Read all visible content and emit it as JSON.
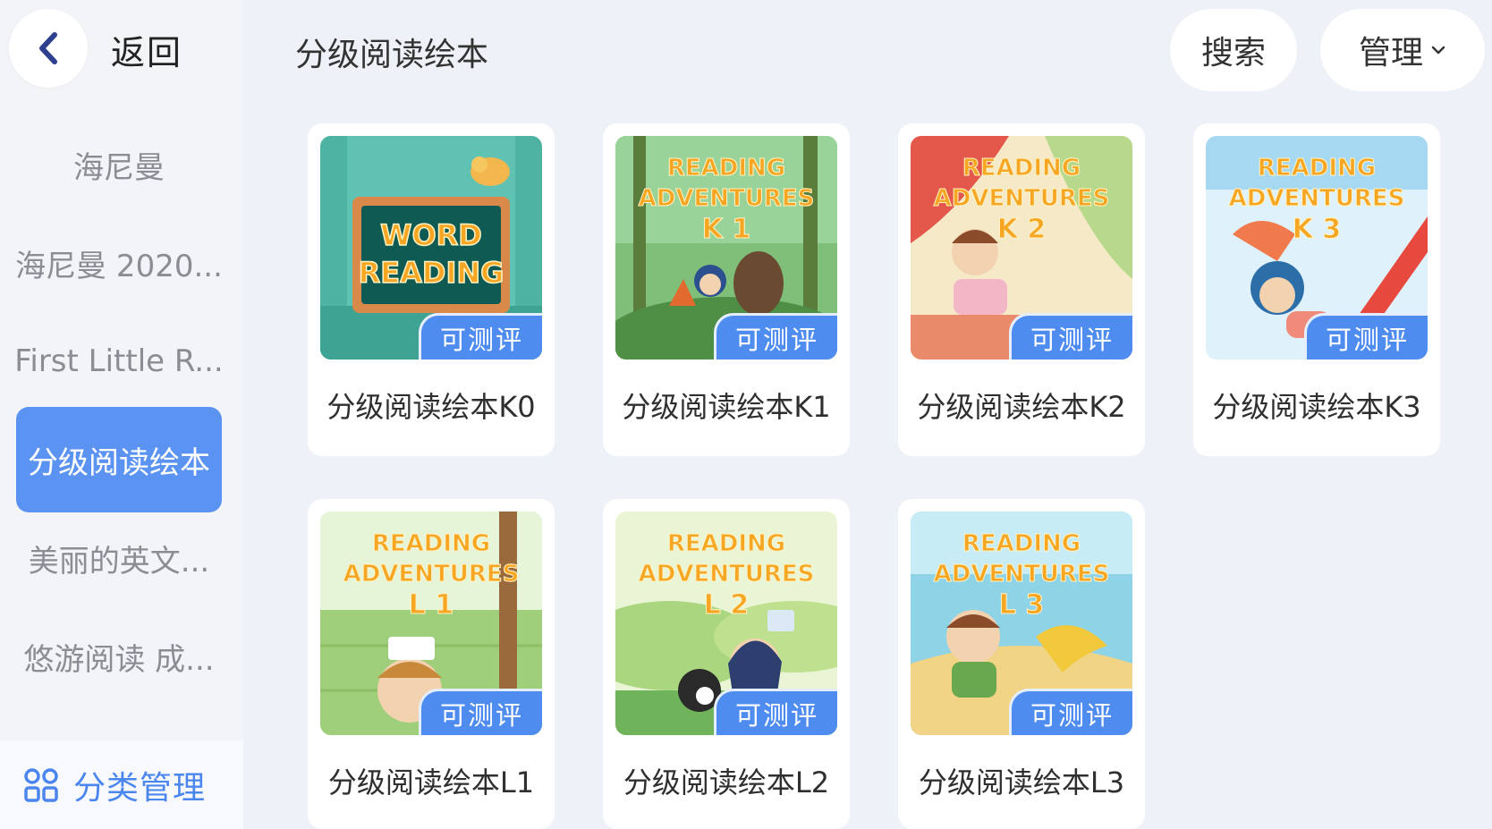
{
  "header": {
    "back_label": "返回",
    "page_title": "分级阅读绘本",
    "search_label": "搜索",
    "manage_label": "管理"
  },
  "sidebar": {
    "items": [
      {
        "label": "海尼曼",
        "active": false
      },
      {
        "label": "海尼曼 2020...",
        "active": false
      },
      {
        "label": "First Little R...",
        "active": false
      },
      {
        "label": "分级阅读绘本",
        "active": true
      },
      {
        "label": "美丽的英文...",
        "active": false
      },
      {
        "label": "悠游阅读 成...",
        "active": false
      }
    ],
    "manage_label": "分类管理"
  },
  "books": [
    {
      "title": "分级阅读绘本K0",
      "badge": "可测评",
      "cover_lines": [
        "WORD",
        "READING"
      ]
    },
    {
      "title": "分级阅读绘本K1",
      "badge": "可测评",
      "cover_lines": [
        "READING",
        "ADVENTURES",
        "K 1"
      ]
    },
    {
      "title": "分级阅读绘本K2",
      "badge": "可测评",
      "cover_lines": [
        "READING",
        "ADVENTURES",
        "K 2"
      ]
    },
    {
      "title": "分级阅读绘本K3",
      "badge": "可测评",
      "cover_lines": [
        "READING",
        "ADVENTURES",
        "K 3"
      ]
    },
    {
      "title": "分级阅读绘本L1",
      "badge": "可测评",
      "cover_lines": [
        "READING",
        "ADVENTURES",
        "L 1"
      ]
    },
    {
      "title": "分级阅读绘本L2",
      "badge": "可测评",
      "cover_lines": [
        "READING",
        "ADVENTURES",
        "L 2"
      ]
    },
    {
      "title": "分级阅读绘本L3",
      "badge": "可测评",
      "cover_lines": [
        "READING",
        "ADVENTURES",
        "L 3"
      ]
    }
  ],
  "colors": {
    "accent": "#5a93f1",
    "badge": "#4f8cf0",
    "cover_title_orange": "#f6a623"
  },
  "icons": {
    "back": "chevron-left-icon",
    "manage_dropdown": "chevron-down-icon",
    "category_manage": "grid-icon"
  }
}
